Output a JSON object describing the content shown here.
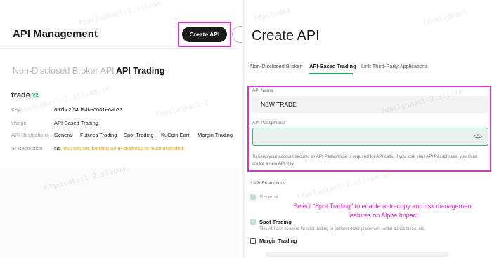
{
  "left": {
    "title": "API Management",
    "create_button": "Create API",
    "tabs": [
      {
        "label": "Non-Disclosed Broker API",
        "active": false
      },
      {
        "label": "API Trading",
        "active": true
      }
    ],
    "key": {
      "name": "trade",
      "version_badge": "V2",
      "rows": [
        {
          "label": "Key",
          "value": "657bc2f54d8dba0001e6ab33"
        },
        {
          "label": "Usage",
          "value": "API-Based Trading"
        },
        {
          "label": "API Restrictions",
          "permissions": [
            "General",
            "Futures Trading",
            "Spot Trading",
            "KuCoin Earn",
            "Margin Trading"
          ]
        },
        {
          "label": "IP Restriction",
          "value_prefix": "No",
          "value_warning": "less secure; binding an IP address is recommended"
        }
      ]
    }
  },
  "right": {
    "title": "Create API",
    "tabs": [
      {
        "label": "Non-Disclosed Broker",
        "active": false
      },
      {
        "label": "API-Based Trading",
        "active": true
      },
      {
        "label": "Link Third-Party Applications",
        "active": false
      }
    ],
    "form": {
      "api_name_label": "API Name",
      "api_name_value": "NEW TRADE",
      "passphrase_label": "API Passphrase",
      "passphrase_value": "",
      "help_text": "To keep your account secure, an API Passphrase is required for API calls. If you lose your API Passphrase, you must create a new API Key."
    },
    "restrictions_label": "* API Restrictions",
    "options": [
      {
        "label": "General",
        "checked": true,
        "disabled": true
      },
      {
        "label": "Spot Trading",
        "checked": true,
        "desc": "This API can be used for spot trading to perform order placement, order cancellation, etc."
      },
      {
        "label": "Margin Trading",
        "checked": false
      }
    ],
    "annotation": "Select \"Spot Trading\" to enable auto-copy and risk management features on Alpha Impact"
  },
  "colors": {
    "highlight": "#e032c8",
    "accent_green": "#27a36b",
    "warning": "#f5a300",
    "button_dark": "#1b1b1b"
  },
  "icons": [
    "eye-icon",
    "checkbox-icon"
  ]
}
